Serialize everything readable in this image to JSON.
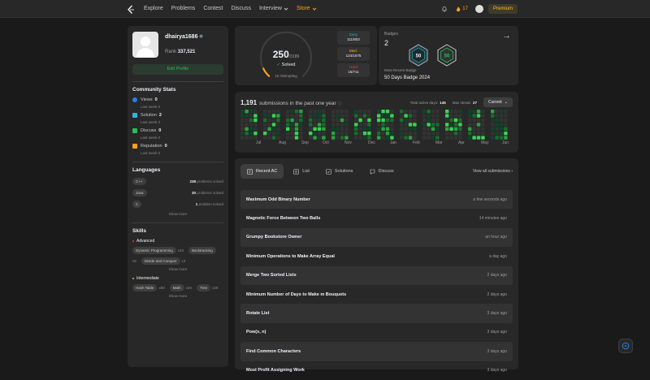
{
  "nav": {
    "items": [
      "Explore",
      "Problems",
      "Contest",
      "Discuss"
    ],
    "interview": "Interview",
    "store": "Store",
    "streak": "17",
    "premium": "Premium"
  },
  "profile": {
    "username": "dhairya1686",
    "rank_label": "Rank",
    "rank": "337,521",
    "edit": "Edit Profile"
  },
  "community": {
    "title": "Community Stats",
    "items": [
      {
        "label": "Views",
        "value": "0",
        "sub": "Last week 0",
        "color": "#2b7de9"
      },
      {
        "label": "Solution",
        "value": "2",
        "sub": "Last week 0",
        "color": "#2db4d8"
      },
      {
        "label": "Discuss",
        "value": "0",
        "sub": "Last week 0",
        "color": "#2cbb5d"
      },
      {
        "label": "Reputation",
        "value": "0",
        "sub": "Last week 0",
        "color": "#ffa116"
      }
    ]
  },
  "languages": {
    "title": "Languages",
    "items": [
      {
        "name": "C++",
        "count": "238",
        "label": "problems solved"
      },
      {
        "name": "Java",
        "count": "30",
        "label": "problems solved"
      },
      {
        "name": "C",
        "count": "1",
        "label": "problem solved"
      }
    ],
    "more": "Show more"
  },
  "skills": {
    "title": "Skills",
    "advanced": {
      "label": "Advanced",
      "tags": [
        [
          "Dynamic Programming",
          "x43"
        ],
        [
          "Backtracking",
          "x9"
        ],
        [
          "Divide and Conquer",
          "x3"
        ]
      ]
    },
    "intermediate": {
      "label": "Intermediate",
      "tags": [
        [
          "Hash Table",
          "x80"
        ],
        [
          "Math",
          "x25"
        ],
        [
          "Tree",
          "x29"
        ]
      ]
    },
    "more": "Show more"
  },
  "solved": {
    "count": "250",
    "total": "/3189",
    "label": "Solved",
    "attempting": "10 Attempting",
    "fraction": 0.0784,
    "easy": {
      "label": "Easy",
      "value": "111/803",
      "color": "#1cbaba"
    },
    "medium": {
      "label": "Med.",
      "value": "124/1675",
      "color": "#ffb700"
    },
    "hard": {
      "label": "Hard",
      "value": "15/711",
      "color": "#f63737"
    }
  },
  "badges": {
    "title": "Badges",
    "count": "2",
    "recent_label": "Most Recent Badge",
    "recent": "50 Days Badge 2024",
    "b1": "50",
    "b2": "50"
  },
  "heatmap": {
    "count": "1,191",
    "label": "submissions in the past one year",
    "active_label": "Total active days:",
    "active": "145",
    "streak_label": "Max streak:",
    "streak": "27",
    "select": "Current",
    "months": [
      "Jul",
      "Aug",
      "Sep",
      "Oct",
      "Nov",
      "Dec",
      "Jan",
      "Feb",
      "Mar",
      "Apr",
      "May",
      "Jun"
    ]
  },
  "recent": {
    "tabs": [
      "Recent AC",
      "List",
      "Solutions",
      "Discuss"
    ],
    "viewall": "View all submissions",
    "items": [
      {
        "title": "Maximum Odd Binary Number",
        "time": "a few seconds ago"
      },
      {
        "title": "Magnetic Force Between Two Balls",
        "time": "14 minutes ago"
      },
      {
        "title": "Grumpy Bookstore Owner",
        "time": "an hour ago"
      },
      {
        "title": "Minimum Operations to Make Array Equal",
        "time": "a day ago"
      },
      {
        "title": "Merge Two Sorted Lists",
        "time": "2 days ago"
      },
      {
        "title": "Minimum Number of Days to Make m Bouquets",
        "time": "2 days ago"
      },
      {
        "title": "Rotate List",
        "time": "3 days ago"
      },
      {
        "title": "Pow(x, n)",
        "time": "3 days ago"
      },
      {
        "title": "Find Common Characters",
        "time": "3 days ago"
      },
      {
        "title": "Most Profit Assigning Work",
        "time": "3 days ago"
      }
    ]
  }
}
